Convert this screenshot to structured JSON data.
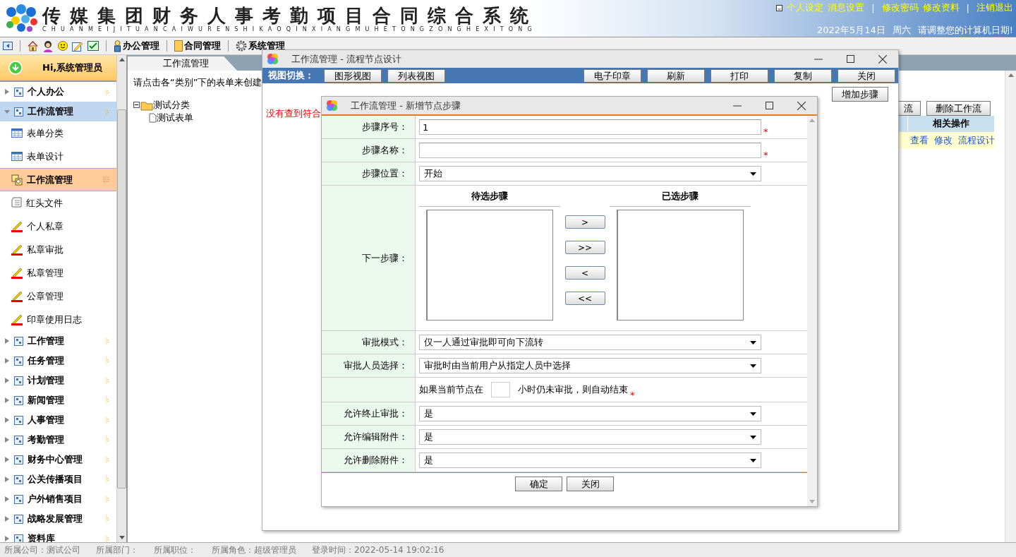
{
  "header": {
    "title": "传媒集团财务人事考勤项目合同综合系统",
    "subtitle": "CHUANMEIJITUANCAIWURENSHIKAOQINXIANGMUHETONGZONGHEXITONG",
    "links": [
      {
        "label": "个人设定"
      },
      {
        "label": "消息设置"
      },
      {
        "label": "|",
        "kind": "sep"
      },
      {
        "label": "修改密码"
      },
      {
        "label": "修改资料"
      },
      {
        "label": "|",
        "kind": "sep"
      },
      {
        "label": "注销退出"
      }
    ],
    "date": "2022年5月14日",
    "weekday": "周六",
    "notice": "请调整您的计算机日期!"
  },
  "toolbar": {
    "menus": [
      {
        "label": "办公管理",
        "kind": "user"
      },
      {
        "label": "合同管理",
        "kind": "folder"
      },
      {
        "label": "系统管理",
        "kind": "gear"
      }
    ]
  },
  "sidebar": {
    "greeting": "Hi,系统管理员",
    "items": [
      {
        "label": "个人办公",
        "expanded": false
      },
      {
        "label": "工作流管理",
        "expanded": true,
        "children": [
          {
            "label": "表单分类",
            "kind": "table",
            "selected": false
          },
          {
            "label": "表单设计",
            "kind": "table",
            "selected": false
          },
          {
            "label": "工作流管理",
            "kind": "workflow",
            "selected": true
          },
          {
            "label": "红头文件",
            "kind": "doc",
            "selected": false
          },
          {
            "label": "个人私章",
            "kind": "pen",
            "selected": false
          },
          {
            "label": "私章审批",
            "kind": "pen",
            "selected": false
          },
          {
            "label": "私章管理",
            "kind": "pen",
            "selected": false
          },
          {
            "label": "公章管理",
            "kind": "pen",
            "selected": false
          },
          {
            "label": "印章使用日志",
            "kind": "pen",
            "selected": false
          }
        ]
      },
      {
        "label": "工作管理",
        "expanded": false
      },
      {
        "label": "任务管理",
        "expanded": false
      },
      {
        "label": "计划管理",
        "expanded": false
      },
      {
        "label": "新闻管理",
        "expanded": false
      },
      {
        "label": "人事管理",
        "expanded": false
      },
      {
        "label": "考勤管理",
        "expanded": false
      },
      {
        "label": "财务中心管理",
        "expanded": false
      },
      {
        "label": "公关传播项目",
        "expanded": false
      },
      {
        "label": "户外销售项目",
        "expanded": false
      },
      {
        "label": "战略发展管理",
        "expanded": false
      },
      {
        "label": "资料库",
        "expanded": false
      }
    ]
  },
  "content": {
    "tab": "工作流管理",
    "intro": "请点击各“类别”下的表单来创建",
    "tree": {
      "label": "测试分类",
      "expanded": true,
      "children": [
        {
          "label": "测试表单"
        }
      ]
    },
    "buttons": [
      "流",
      "删除工作流"
    ],
    "table": {
      "columns": [
        "相关操作"
      ],
      "rows": [
        {
          "actions": [
            "查看",
            "修改",
            "流程设计"
          ]
        }
      ]
    }
  },
  "designer": {
    "title": "工作流管理 - 流程节点设计",
    "view_label": "视图切换：",
    "view_buttons": [
      "图形视图",
      "列表视图"
    ],
    "actions": [
      "电子印章",
      "刷新",
      "打印",
      "复制",
      "关闭"
    ],
    "add_button": "增加步骤",
    "empty_message": "没有查到符合"
  },
  "dialog": {
    "title": "工作流管理 - 新增节点步骤",
    "fields": [
      {
        "kind": "input",
        "label": "步骤序号：",
        "value": "1",
        "required_mark": "*"
      },
      {
        "kind": "input",
        "label": "步骤名称：",
        "required_mark": "*"
      },
      {
        "kind": "select",
        "label": "步骤位置：",
        "value": "开始"
      },
      {
        "kind": "transfer",
        "label": "下一步骤：",
        "left_title": "待选步骤",
        "right_title": "已选步骤",
        "buttons": [
          ">",
          ">>",
          "<",
          "<<"
        ]
      },
      {
        "kind": "select",
        "label": "审批模式：",
        "value": "仅一人通过审批即可向下流转"
      },
      {
        "kind": "select",
        "label": "审批人员选择：",
        "value": "审批时由当前用户从指定人员中选择"
      },
      {
        "kind": "timeout",
        "prefix": "如果当前节点在",
        "suffix": "小时仍未审批，则自动结束",
        "required_mark": "*"
      },
      {
        "kind": "select",
        "label": "允许终止审批：",
        "value": "是"
      },
      {
        "kind": "select",
        "label": "允许编辑附件：",
        "value": "是"
      },
      {
        "kind": "select",
        "label": "允许删除附件：",
        "value": "是"
      }
    ],
    "buttons": [
      "确定",
      "关闭"
    ]
  },
  "status_bar": [
    "所属公司：测试公司",
    "所属部门：",
    "所属职位：",
    "所属角色：超级管理员",
    "登录时间：2022-05-14 19:02:16"
  ]
}
